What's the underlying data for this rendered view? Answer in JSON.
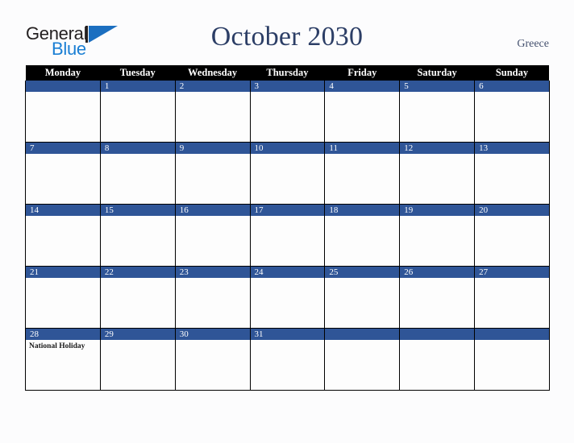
{
  "header": {
    "logo": {
      "word_one": "General",
      "word_two": "Blue",
      "mark": "triangle-flag-mark"
    },
    "title": "October 2030",
    "country": "Greece"
  },
  "calendar": {
    "weekday_headers": [
      "Monday",
      "Tuesday",
      "Wednesday",
      "Thursday",
      "Friday",
      "Saturday",
      "Sunday"
    ],
    "colors": {
      "header_row_background": "#000000",
      "header_row_text": "#FFFFFF",
      "day_band_background": "#2F5597",
      "day_band_text": "#FFFFFF",
      "cell_background": "#FDFDFD",
      "grid_border": "#000000",
      "page_background": "#FCFCFD",
      "title_text": "#2C3E66",
      "country_text": "#44506E",
      "logo_blue": "#1B7FD4",
      "logo_dark": "#231F20"
    },
    "weeks": [
      [
        {
          "day": "",
          "events": []
        },
        {
          "day": "1",
          "events": []
        },
        {
          "day": "2",
          "events": []
        },
        {
          "day": "3",
          "events": []
        },
        {
          "day": "4",
          "events": []
        },
        {
          "day": "5",
          "events": []
        },
        {
          "day": "6",
          "events": []
        }
      ],
      [
        {
          "day": "7",
          "events": []
        },
        {
          "day": "8",
          "events": []
        },
        {
          "day": "9",
          "events": []
        },
        {
          "day": "10",
          "events": []
        },
        {
          "day": "11",
          "events": []
        },
        {
          "day": "12",
          "events": []
        },
        {
          "day": "13",
          "events": []
        }
      ],
      [
        {
          "day": "14",
          "events": []
        },
        {
          "day": "15",
          "events": []
        },
        {
          "day": "16",
          "events": []
        },
        {
          "day": "17",
          "events": []
        },
        {
          "day": "18",
          "events": []
        },
        {
          "day": "19",
          "events": []
        },
        {
          "day": "20",
          "events": []
        }
      ],
      [
        {
          "day": "21",
          "events": []
        },
        {
          "day": "22",
          "events": []
        },
        {
          "day": "23",
          "events": []
        },
        {
          "day": "24",
          "events": []
        },
        {
          "day": "25",
          "events": []
        },
        {
          "day": "26",
          "events": []
        },
        {
          "day": "27",
          "events": []
        }
      ],
      [
        {
          "day": "28",
          "events": [
            "National Holiday"
          ]
        },
        {
          "day": "29",
          "events": []
        },
        {
          "day": "30",
          "events": []
        },
        {
          "day": "31",
          "events": []
        },
        {
          "day": "",
          "events": []
        },
        {
          "day": "",
          "events": []
        },
        {
          "day": "",
          "events": []
        }
      ]
    ]
  }
}
